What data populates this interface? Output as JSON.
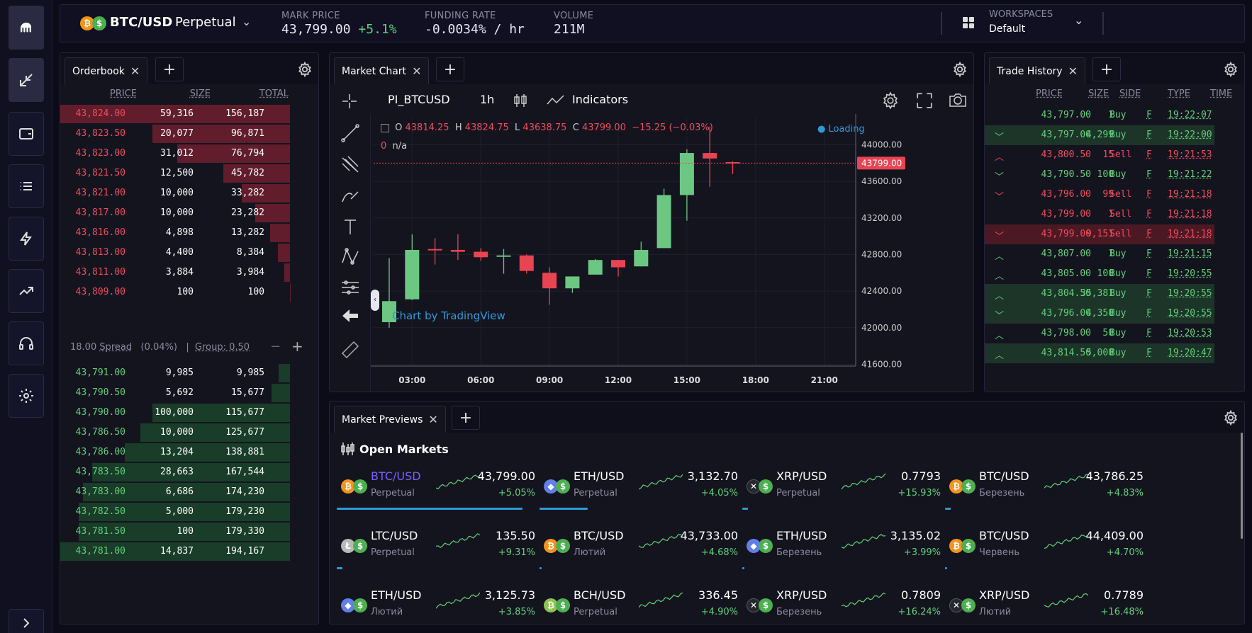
{
  "sidebar": {
    "items": [
      "kraken-logo",
      "swap",
      "wallet",
      "list",
      "lightning",
      "trending",
      "headset",
      "settings",
      "expand"
    ]
  },
  "header": {
    "symbol": "BTC/USD",
    "contract": "Perpetual",
    "mark_price_label": "MARK PRICE",
    "mark_price": "43,799.00",
    "mark_change": "+5.1%",
    "funding_label": "FUNDING RATE",
    "funding_value": "-0.0034% / hr",
    "volume_label": "VOLUME",
    "volume_value": "211M",
    "workspaces_label": "WORKSPACES",
    "workspace_value": "Default"
  },
  "orderbook": {
    "tab": "Orderbook",
    "col_price": "PRICE",
    "col_size": "SIZE",
    "col_total": "TOTAL",
    "asks": [
      {
        "price": "43,824.00",
        "size": "59,316",
        "total": "156,187",
        "depth": 1.0
      },
      {
        "price": "43,823.50",
        "size": "20,077",
        "total": "96,871",
        "depth": 0.6
      },
      {
        "price": "43,823.00",
        "size": "31,012",
        "total": "76,794",
        "depth": 0.49
      },
      {
        "price": "43,821.50",
        "size": "12,500",
        "total": "45,782",
        "depth": 0.29
      },
      {
        "price": "43,821.00",
        "size": "10,000",
        "total": "33,282",
        "depth": 0.21
      },
      {
        "price": "43,817.00",
        "size": "10,000",
        "total": "23,282",
        "depth": 0.15
      },
      {
        "price": "43,816.00",
        "size": "4,898",
        "total": "13,282",
        "depth": 0.085
      },
      {
        "price": "43,813.00",
        "size": "4,400",
        "total": "8,384",
        "depth": 0.054
      },
      {
        "price": "43,811.00",
        "size": "3,884",
        "total": "3,984",
        "depth": 0.026
      },
      {
        "price": "43,809.00",
        "size": "100",
        "total": "100",
        "depth": 0.001
      }
    ],
    "spread_value": "18.00",
    "spread_label": "Spread",
    "spread_pct": "(0.04%)",
    "group_label": "Group: 0.50",
    "bids": [
      {
        "price": "43,791.00",
        "size": "9,985",
        "total": "9,985",
        "depth": 0.05
      },
      {
        "price": "43,790.50",
        "size": "5,692",
        "total": "15,677",
        "depth": 0.08
      },
      {
        "price": "43,790.00",
        "size": "100,000",
        "total": "115,677",
        "depth": 0.6
      },
      {
        "price": "43,786.50",
        "size": "10,000",
        "total": "125,677",
        "depth": 0.65
      },
      {
        "price": "43,786.00",
        "size": "13,204",
        "total": "138,881",
        "depth": 0.72
      },
      {
        "price": "43,783.50",
        "size": "28,663",
        "total": "167,544",
        "depth": 0.86
      },
      {
        "price": "43,783.00",
        "size": "6,686",
        "total": "174,230",
        "depth": 0.9
      },
      {
        "price": "43,782.50",
        "size": "5,000",
        "total": "179,230",
        "depth": 0.92
      },
      {
        "price": "43,781.50",
        "size": "100",
        "total": "179,330",
        "depth": 0.92
      },
      {
        "price": "43,781.00",
        "size": "14,837",
        "total": "194,167",
        "depth": 1.0
      }
    ]
  },
  "chart_panel": {
    "tab": "Market Chart",
    "symbol": "PI_BTCUSD",
    "interval": "1h",
    "indicators": "Indicators",
    "legend_o_label": "O",
    "legend_o": "43814.25",
    "legend_h_label": "H",
    "legend_h": "43824.75",
    "legend_l_label": "L",
    "legend_l": "43638.75",
    "legend_c_label": "C",
    "legend_c": "43799.00",
    "legend_change": "−15.25 (−0.03%)",
    "study_value": "0",
    "study_label": "n/a",
    "loading": "Loading",
    "watermark": "Chart by TradingView",
    "last_price_tag": "43799.00"
  },
  "chart_data": {
    "type": "candlestick",
    "y_ticks": [
      "44000.00",
      "43600.00",
      "43200.00",
      "42800.00",
      "42400.00",
      "42000.00",
      "41600.00"
    ],
    "x_ticks": [
      "03:00",
      "06:00",
      "09:00",
      "12:00",
      "15:00",
      "18:00",
      "21:00"
    ],
    "ylim": [
      41580,
      44290
    ],
    "last_price": 43799,
    "candles": [
      {
        "o": 42060,
        "h": 42760,
        "l": 42000,
        "c": 42290
      },
      {
        "o": 42310,
        "h": 43020,
        "l": 42300,
        "c": 42850
      },
      {
        "o": 42860,
        "h": 42980,
        "l": 42690,
        "c": 42850
      },
      {
        "o": 42850,
        "h": 43020,
        "l": 42740,
        "c": 42830
      },
      {
        "o": 42830,
        "h": 42870,
        "l": 42730,
        "c": 42770
      },
      {
        "o": 42790,
        "h": 42860,
        "l": 42590,
        "c": 42790
      },
      {
        "o": 42790,
        "h": 42800,
        "l": 42590,
        "c": 42620
      },
      {
        "o": 42600,
        "h": 42660,
        "l": 42250,
        "c": 42430
      },
      {
        "o": 42430,
        "h": 42560,
        "l": 42380,
        "c": 42560
      },
      {
        "o": 42580,
        "h": 42750,
        "l": 42580,
        "c": 42740
      },
      {
        "o": 42740,
        "h": 42740,
        "l": 42560,
        "c": 42660
      },
      {
        "o": 42670,
        "h": 42940,
        "l": 42670,
        "c": 42850
      },
      {
        "o": 42870,
        "h": 43520,
        "l": 42870,
        "c": 43450
      },
      {
        "o": 43450,
        "h": 43950,
        "l": 43170,
        "c": 43910
      },
      {
        "o": 43910,
        "h": 44200,
        "l": 43540,
        "c": 43850
      },
      {
        "o": 43810,
        "h": 43820,
        "l": 43680,
        "c": 43799
      }
    ]
  },
  "trade_history": {
    "tab": "Trade History",
    "col_price": "PRICE",
    "col_size": "SIZE",
    "col_side": "SIDE",
    "col_type": "TYPE",
    "col_time": "TIME",
    "rows": [
      {
        "dir": "",
        "price": "43,797.00",
        "size": "1",
        "side": "Buy",
        "type": "F",
        "time": "19:22:07",
        "hl": ""
      },
      {
        "dir": "down",
        "price": "43,797.00",
        "size": "4,299",
        "side": "Buy",
        "type": "F",
        "time": "19:22:00",
        "hl": "buy"
      },
      {
        "dir": "up",
        "price": "43,800.50",
        "size": "15",
        "side": "Sell",
        "type": "F",
        "time": "19:21:53",
        "hl": ""
      },
      {
        "dir": "down",
        "price": "43,790.50",
        "size": "100",
        "side": "Buy",
        "type": "F",
        "time": "19:21:22",
        "hl": ""
      },
      {
        "dir": "down",
        "price": "43,796.00",
        "size": "99",
        "side": "Sell",
        "type": "F",
        "time": "19:21:18",
        "hl": ""
      },
      {
        "dir": "",
        "price": "43,799.00",
        "size": "1",
        "side": "Sell",
        "type": "F",
        "time": "19:21:18",
        "hl": ""
      },
      {
        "dir": "down",
        "price": "43,799.00",
        "size": "9,151",
        "side": "Sell",
        "type": "F",
        "time": "19:21:18",
        "hl": "sell"
      },
      {
        "dir": "up",
        "price": "43,807.00",
        "size": "1",
        "side": "Buy",
        "type": "F",
        "time": "19:21:15",
        "hl": ""
      },
      {
        "dir": "up",
        "price": "43,805.00",
        "size": "100",
        "side": "Buy",
        "type": "F",
        "time": "19:20:55",
        "hl": ""
      },
      {
        "dir": "up",
        "price": "43,804.50",
        "size": "35,381",
        "side": "Buy",
        "type": "F",
        "time": "19:20:55",
        "hl": "buy"
      },
      {
        "dir": "down",
        "price": "43,796.00",
        "size": "4,350",
        "side": "Buy",
        "type": "F",
        "time": "19:20:55",
        "hl": "buy"
      },
      {
        "dir": "up",
        "price": "43,798.00",
        "size": "50",
        "side": "Buy",
        "type": "F",
        "time": "19:20:53",
        "hl": ""
      },
      {
        "dir": "up",
        "price": "43,814.50",
        "size": "5,000",
        "side": "Buy",
        "type": "F",
        "time": "19:20:47",
        "hl": "buy"
      }
    ]
  },
  "markets": {
    "tab": "Market Previews",
    "title": "Open Markets",
    "cards": [
      {
        "base": "btc",
        "symbol": "BTC/USD",
        "sub": "Perpetual",
        "price": "43,799.00",
        "change": "+5.05%",
        "volume": 1.0,
        "active": true
      },
      {
        "base": "eth",
        "symbol": "ETH/USD",
        "sub": "Perpetual",
        "price": "3,132.70",
        "change": "+4.05%",
        "volume": 0.26
      },
      {
        "base": "xrp",
        "symbol": "XRP/USD",
        "sub": "Perpetual",
        "price": "0.7793",
        "change": "+15.93%",
        "volume": 0.03
      },
      {
        "base": "btc",
        "symbol": "BTC/USD",
        "sub": "Березень",
        "price": "43,786.25",
        "change": "+4.83%",
        "volume": 0.03
      },
      {
        "base": "ltc",
        "symbol": "LTC/USD",
        "sub": "Perpetual",
        "price": "135.50",
        "change": "+9.31%",
        "volume": 0.03
      },
      {
        "base": "btc",
        "symbol": "BTC/USD",
        "sub": "Лютий",
        "price": "43,733.00",
        "change": "+4.68%",
        "volume": 0.01
      },
      {
        "base": "eth",
        "symbol": "ETH/USD",
        "sub": "Березень",
        "price": "3,135.02",
        "change": "+3.99%",
        "volume": 0.01
      },
      {
        "base": "btc",
        "symbol": "BTC/USD",
        "sub": "Червень",
        "price": "44,409.00",
        "change": "+4.70%",
        "volume": 0.01
      },
      {
        "base": "eth",
        "symbol": "ETH/USD",
        "sub": "Лютий",
        "price": "3,125.73",
        "change": "+3.85%",
        "volume": 0
      },
      {
        "base": "bch",
        "symbol": "BCH/USD",
        "sub": "Perpetual",
        "price": "336.45",
        "change": "+4.90%",
        "volume": 0
      },
      {
        "base": "xrp",
        "symbol": "XRP/USD",
        "sub": "Березень",
        "price": "0.7809",
        "change": "+16.24%",
        "volume": 0
      },
      {
        "base": "xrp",
        "symbol": "XRP/USD",
        "sub": "Лютий",
        "price": "0.7789",
        "change": "+16.48%",
        "volume": 0
      }
    ]
  },
  "colors": {
    "bid": "#5fd07a",
    "ask": "#ef4b5c",
    "candle_up": "#6cc782",
    "candle_down": "#e84452",
    "accent": "#2d9ad8",
    "brand": "#7b61ff"
  }
}
